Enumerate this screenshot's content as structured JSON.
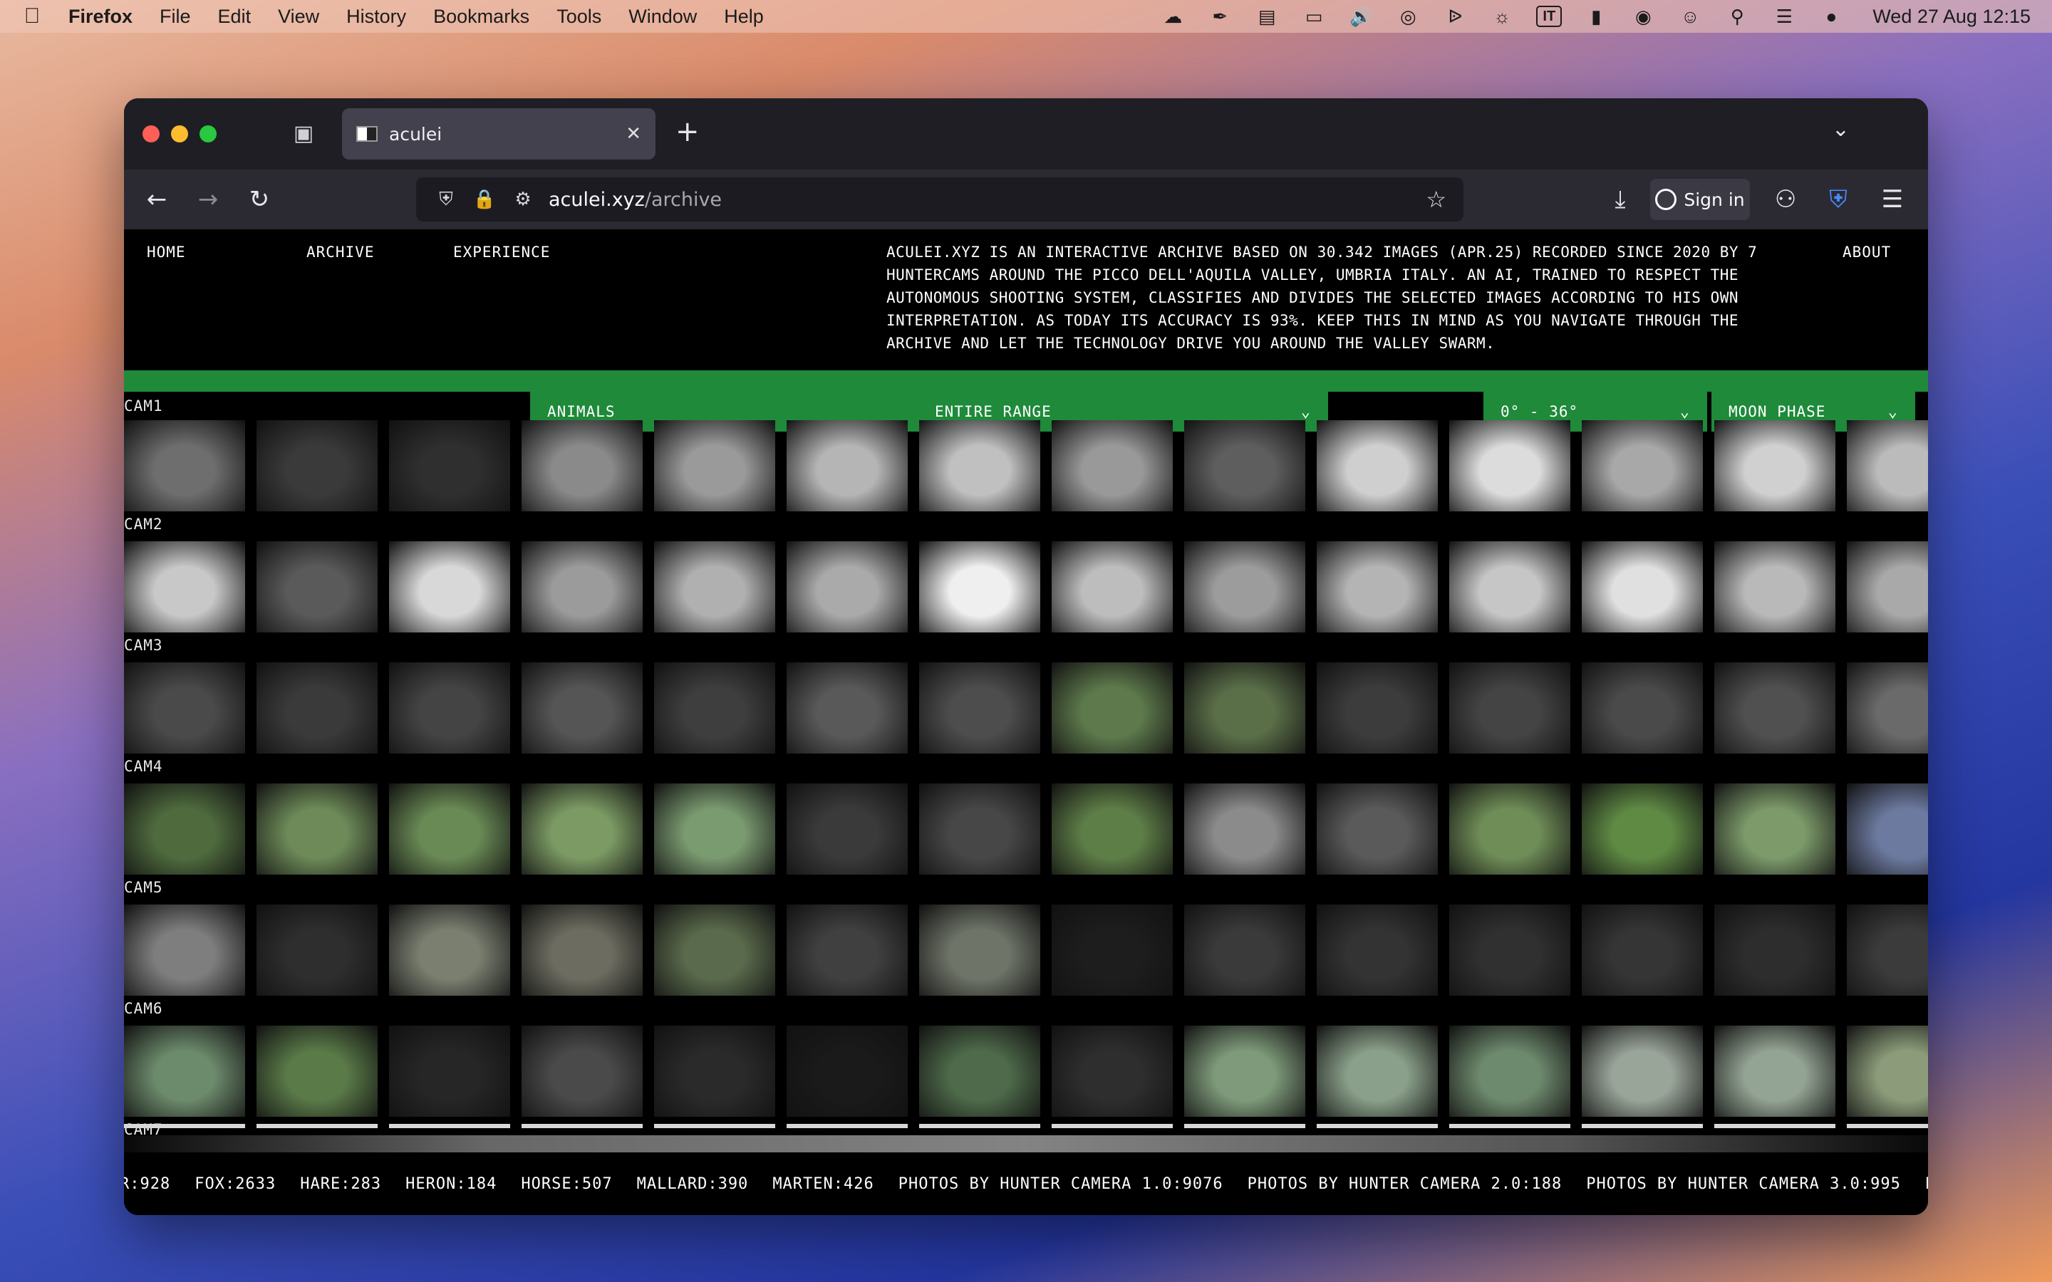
{
  "menubar": {
    "app": "Firefox",
    "items": [
      "File",
      "Edit",
      "View",
      "History",
      "Bookmarks",
      "Tools",
      "Window",
      "Help"
    ],
    "input_source": "IT",
    "datetime": "Wed 27 Aug  12:15"
  },
  "browser": {
    "tab_title": "aculei",
    "url_host": "aculei.xyz",
    "url_path": "/archive",
    "signin_label": "Sign in"
  },
  "site": {
    "nav": [
      "HOME",
      "ARCHIVE",
      "EXPERIENCE"
    ],
    "about": "ABOUT",
    "intro": "ACULEI.XYZ IS AN INTERACTIVE ARCHIVE BASED ON 30.342 IMAGES (APR.25) RECORDED SINCE 2020 BY 7 HUNTERCAMS AROUND THE PICCO DELL'AQUILA VALLEY, UMBRIA ITALY. AN AI, TRAINED TO RESPECT THE AUTONOMOUS SHOOTING SYSTEM, CLASSIFIES AND DIVIDES THE SELECTED IMAGES ACCORDING TO HIS OWN INTERPRETATION. AS TODAY ITS ACCURACY IS 93%. KEEP THIS IN MIND AS YOU NAVIGATE THROUGH THE ARCHIVE AND LET THE TECHNOLOGY DRIVE YOU AROUND THE VALLEY SWARM.",
    "filters": {
      "animal": "ANIMALS",
      "date_range": "ENTIRE RANGE",
      "temperature": "0° - 36°",
      "moon": "MOON PHASE"
    },
    "cams": [
      "CAM1",
      "CAM2",
      "CAM3",
      "CAM4",
      "CAM5",
      "CAM6",
      "CAM7"
    ],
    "ticker": [
      "R:928",
      "FOX:2633",
      "HARE:283",
      "HERON:184",
      "HORSE:507",
      "MALLARD:390",
      "MARTEN:426",
      "PHOTOS BY HUNTER CAMERA 1.0:9076",
      "PHOTOS BY HUNTER CAMERA 2.0:188",
      "PHOTOS BY HUNTER CAMERA 3.0:995",
      "PHOTOS BY HUNTER"
    ]
  },
  "colors": {
    "accent_green": "#1e8a3a",
    "page_bg": "#000000"
  }
}
